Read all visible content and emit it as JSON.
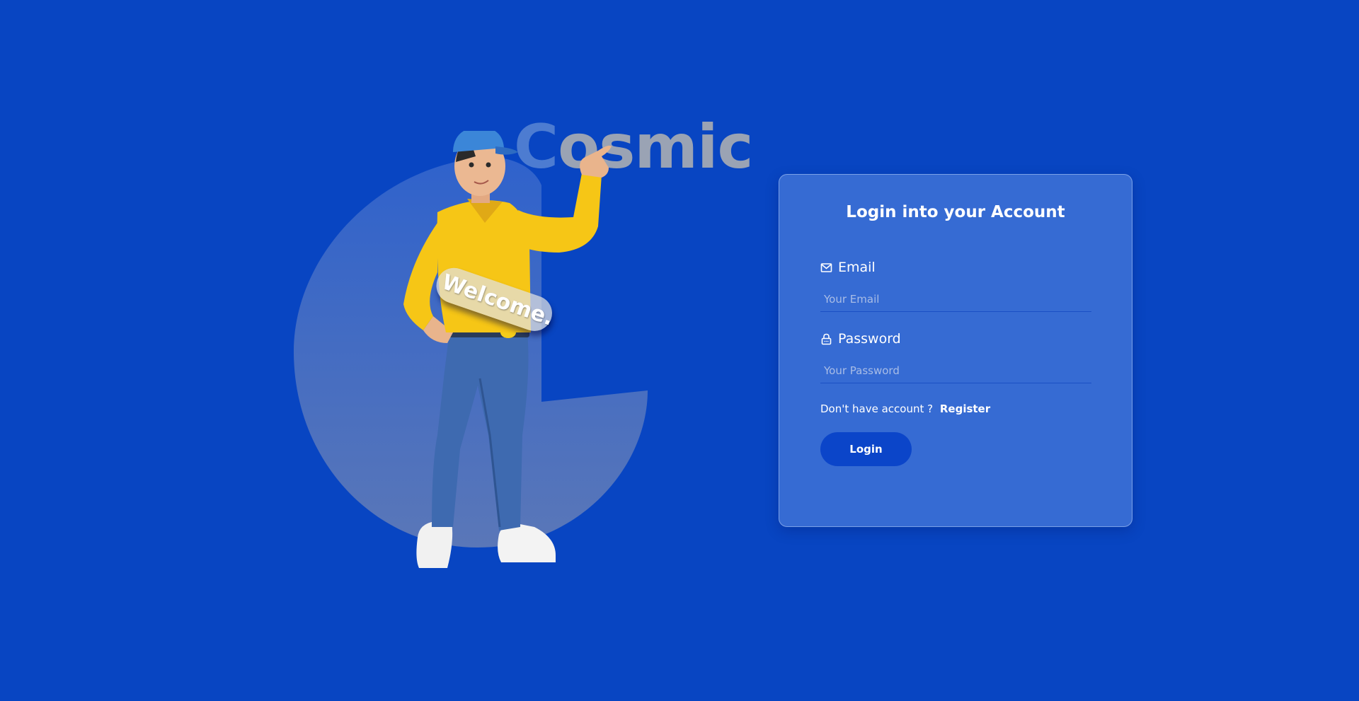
{
  "hero": {
    "brand_initial": "C",
    "brand_rest": "osmic",
    "welcome_text": "Welcome."
  },
  "login_card": {
    "title": "Login into your Account",
    "email": {
      "label": "Email",
      "placeholder": "Your Email",
      "value": "",
      "icon": "mail-icon"
    },
    "password": {
      "label": "Password",
      "placeholder": "Your Password",
      "value": "",
      "icon": "lock-icon"
    },
    "register_prompt": "Don't have account ?",
    "register_link": "Register",
    "login_button": "Login"
  },
  "colors": {
    "background": "#0845c2",
    "card": "#6f96e3",
    "button": "#0b45c9",
    "shirt": "#f6c616",
    "jeans": "#3e6ab0",
    "cap": "#3b86d8"
  }
}
